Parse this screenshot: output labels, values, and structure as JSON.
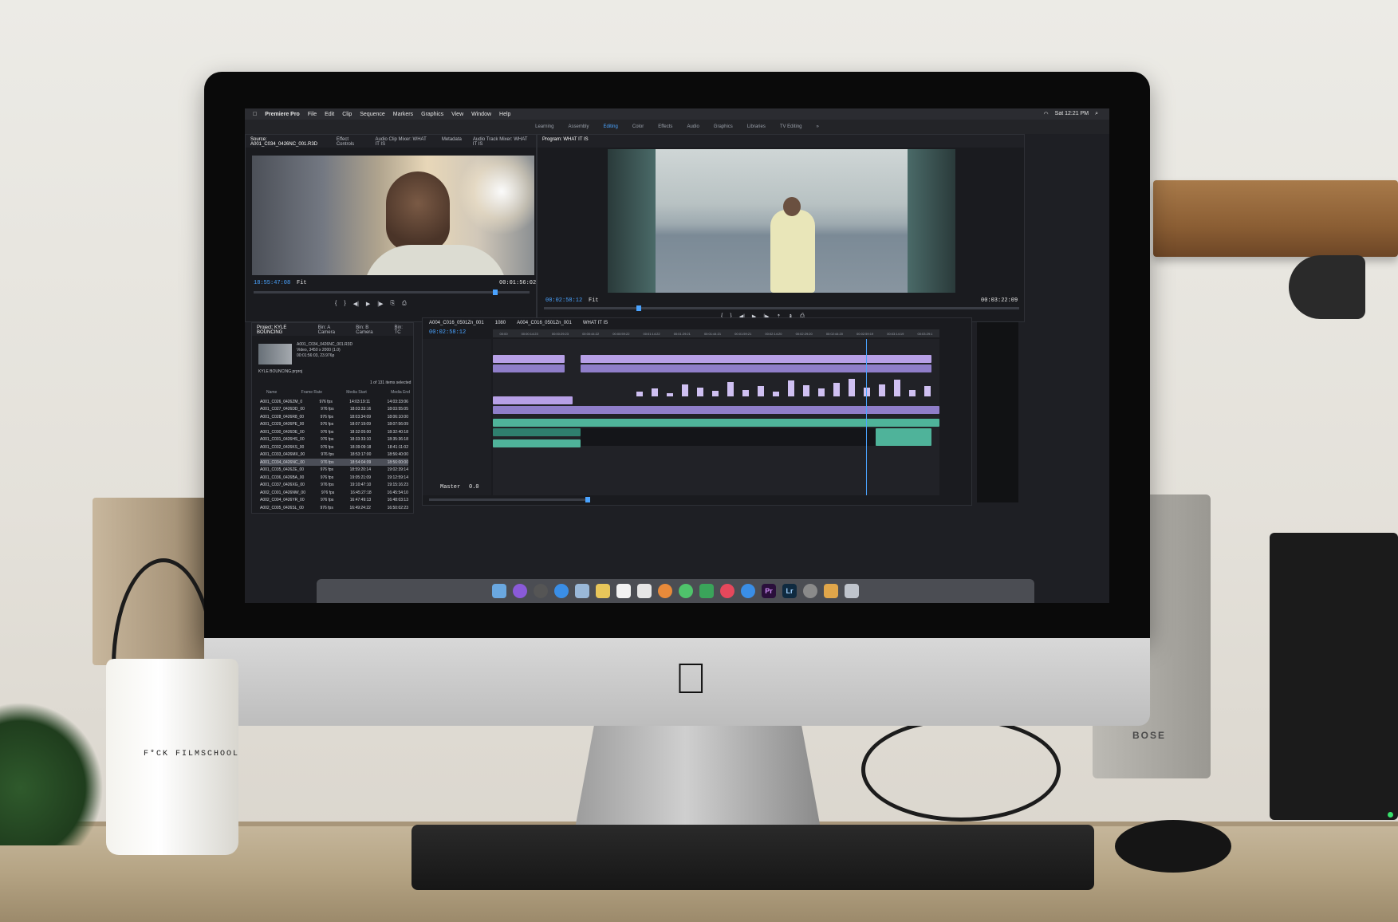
{
  "menubar": {
    "app": "Premiere Pro",
    "items": [
      "File",
      "Edit",
      "Clip",
      "Sequence",
      "Markers",
      "Graphics",
      "View",
      "Window",
      "Help"
    ],
    "clock": "Sat 12:21 PM"
  },
  "workspaces": {
    "items": [
      "Learning",
      "Assembly",
      "Editing",
      "Color",
      "Effects",
      "Audio",
      "Graphics",
      "Libraries",
      "TV Editing"
    ],
    "active": "Editing"
  },
  "source_panel": {
    "tabs": [
      "Source: A001_C034_0426NC_001.R3D",
      "Effect Controls",
      "Audio Clip Mixer: WHAT IT IS",
      "Metadata",
      "Audio Track Mixer: WHAT IT IS"
    ],
    "timecode_left": "18:55:47:08",
    "zoom": "Fit",
    "timecode_right": "00:01:56:02"
  },
  "program_panel": {
    "tab": "Program: WHAT IT IS",
    "timecode_left": "00:02:58:12",
    "zoom": "Fit",
    "timecode_right": "00:03:22:09"
  },
  "project_panel": {
    "tabs": [
      "Project: KYLE BOUNCING",
      "Bin: A Camera",
      "Bin: B Camera",
      "Bin: TC"
    ],
    "clip_name": "A001_C034_0426NC_001.R3D",
    "clip_info": "Video, 3450 x 2000 (1.0)",
    "clip_time": "00:01:56:03, 23.976p",
    "bin": "KYLE BOUNCING.prproj",
    "items_selected": "1 of 131 items selected",
    "columns": [
      "Name",
      "Frame Rate",
      "Media Start",
      "Media End"
    ],
    "rows": [
      {
        "name": "A001_C026_0426ZM_0",
        "rate": "976 fps",
        "start": "14:03:19:11",
        "end": "14:03:33:06"
      },
      {
        "name": "A001_C027_0426DD_00",
        "rate": "976 fps",
        "start": "18:03:33:16",
        "end": "18:03:55:05"
      },
      {
        "name": "A001_C028_0426R8_00",
        "rate": "976 fps",
        "start": "18:03:34:09",
        "end": "18:06:10:00"
      },
      {
        "name": "A001_C029_0426PE_00",
        "rate": "976 fps",
        "start": "18:07:19:09",
        "end": "18:07:56:09"
      },
      {
        "name": "A001_C030_0426DE_00",
        "rate": "976 fps",
        "start": "18:32:05:00",
        "end": "18:32:40:18"
      },
      {
        "name": "A001_C031_0426HS_00",
        "rate": "976 fps",
        "start": "18:33:33:10",
        "end": "18:35:36:18"
      },
      {
        "name": "A001_C032_0426KS_00",
        "rate": "976 fps",
        "start": "18:39:09:18",
        "end": "18:41:11:02"
      },
      {
        "name": "A001_C033_0426MX_00",
        "rate": "976 fps",
        "start": "18:53:17:00",
        "end": "18:56:40:00"
      },
      {
        "name": "A001_C034_0426NC_00",
        "rate": "976 fps",
        "start": "18:54:04:09",
        "end": "18:56:00:00"
      },
      {
        "name": "A001_C035_0426ZE_00",
        "rate": "976 fps",
        "start": "18:59:20:14",
        "end": "19:02:39:14"
      },
      {
        "name": "A001_C036_0426BA_00",
        "rate": "976 fps",
        "start": "19:05:21:09",
        "end": "19:12:59:14"
      },
      {
        "name": "A001_C037_0426XG_00",
        "rate": "976 fps",
        "start": "19:10:47:10",
        "end": "19:15:16:23"
      },
      {
        "name": "A002_C001_0426NW_00",
        "rate": "976 fps",
        "start": "16:45:27:18",
        "end": "16:45:54:10"
      },
      {
        "name": "A002_C004_0426YR_00",
        "rate": "976 fps",
        "start": "16:47:49:13",
        "end": "16:48:03:13"
      },
      {
        "name": "A002_C005_0426SL_00",
        "rate": "976 fps",
        "start": "16:49:24:22",
        "end": "16:50:02:23"
      }
    ],
    "selected_index": 8
  },
  "timeline": {
    "tabs": [
      "A004_C016_0501Zn_001",
      "1080",
      "A004_C016_0501Zn_001",
      "WHAT IT IS"
    ],
    "timecode": "00:02:58:12",
    "ruler": [
      "00:00",
      "00:00:14:23",
      "00:00:29:23",
      "00:00:44:22",
      "00:00:59:22",
      "00:01:14:22",
      "00:01:29:21",
      "00:01:44:21",
      "00:01:59:21",
      "00:02:14:20",
      "00:02:29:20",
      "00:02:44:20",
      "00:02:59:19",
      "00:03:14:19",
      "00:03:29:1"
    ],
    "master": "Master",
    "master_value": "0.0",
    "playhead_fraction": 0.835,
    "audio_peaks": [
      0.2,
      0.35,
      0.15,
      0.55,
      0.4,
      0.25,
      0.65,
      0.3,
      0.45,
      0.2,
      0.7,
      0.5,
      0.35,
      0.6,
      0.8,
      0.4,
      0.55,
      0.75,
      0.3,
      0.45
    ]
  },
  "dock": {
    "premiere": "Pr",
    "lightroom": "Lr"
  },
  "mug": {
    "text": "F*CK FILMSCHOOL"
  },
  "speaker": {
    "brand": "BOSE"
  }
}
